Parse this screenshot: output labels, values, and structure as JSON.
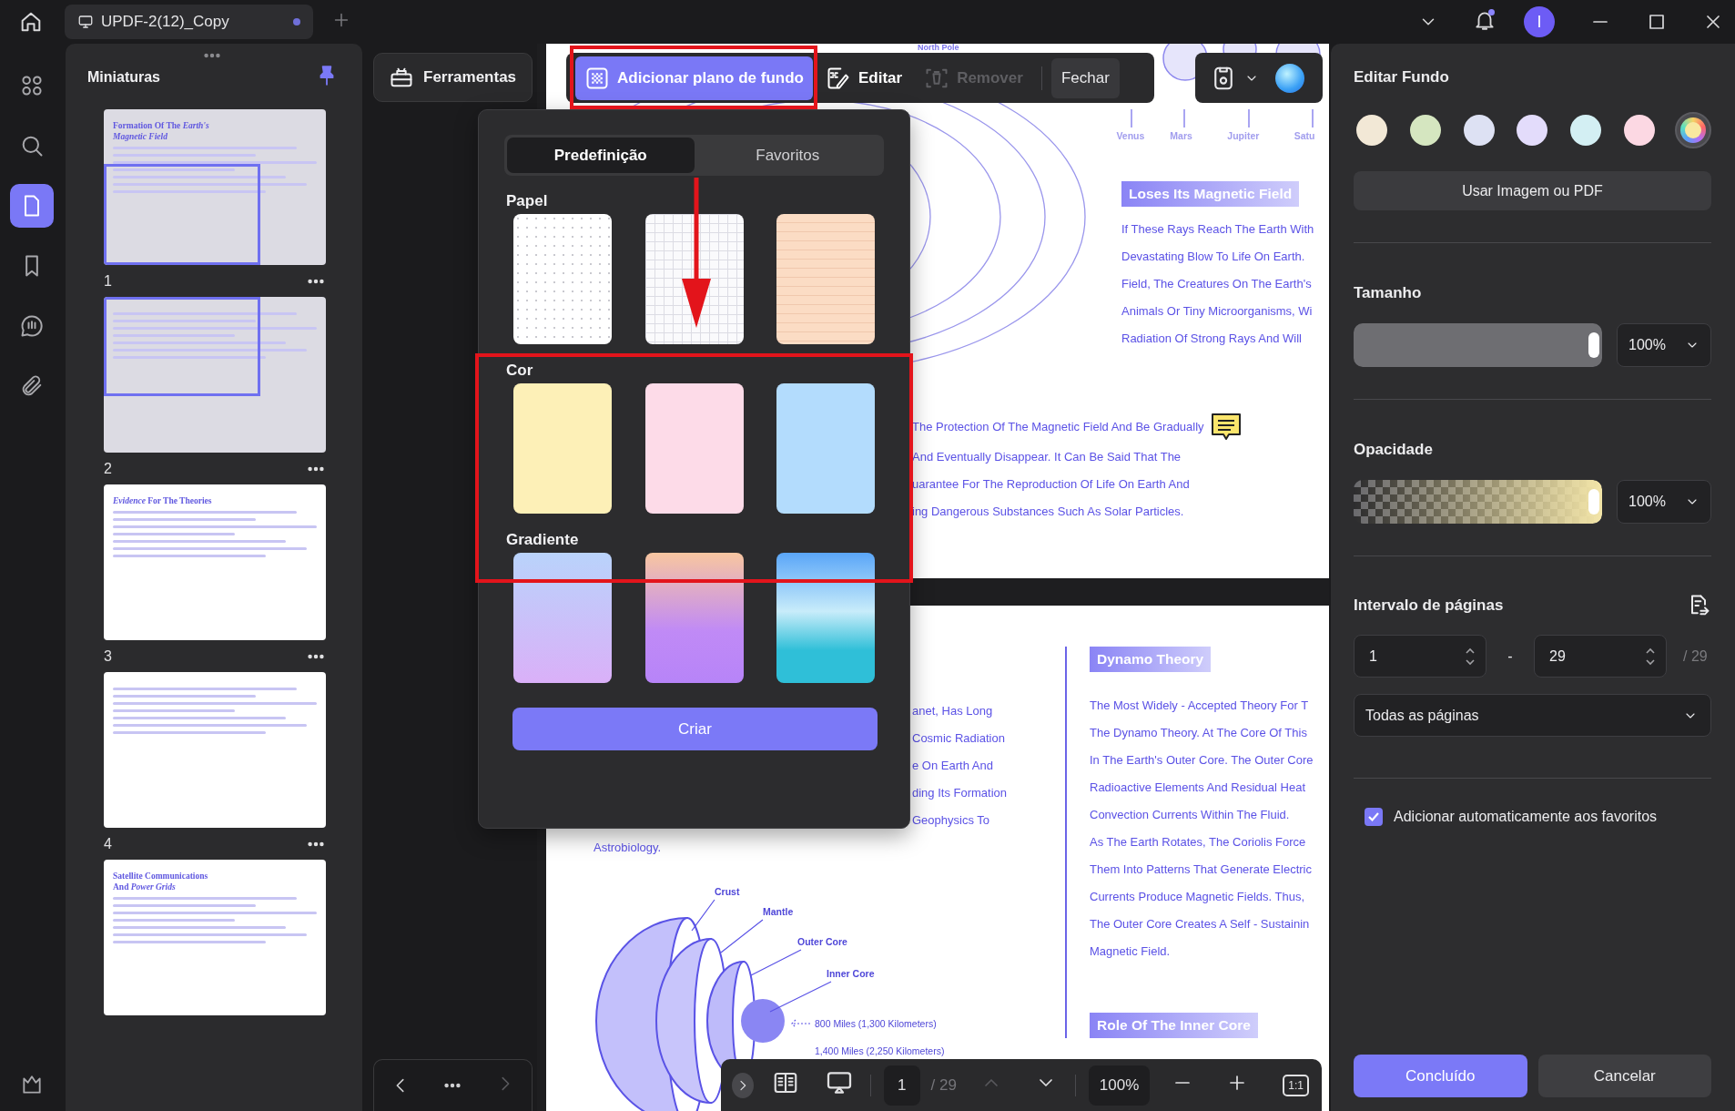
{
  "top_bar": {
    "tab_title": "UPDF-2(12)_Copy",
    "unsaved": true,
    "avatar_letter": "I"
  },
  "nav_rail": [
    {
      "selected": false
    },
    {
      "selected": false
    },
    {
      "selected": true
    },
    {
      "selected": false
    },
    {
      "selected": false
    },
    {
      "selected": false
    }
  ],
  "thumbnails": {
    "title": "Miniaturas",
    "pinned": true,
    "pages": [
      {
        "label": "1",
        "title": "Formation Of The *Earth's Magnetic Field*",
        "in_view": true
      },
      {
        "label": "2",
        "in_view": true
      },
      {
        "label": "3",
        "title": "*Evidence* For The Theories",
        "in_view": false
      },
      {
        "label": "4",
        "in_view": false
      },
      {
        "title": "Satellite Communications And *Power Grids*",
        "in_view": false
      }
    ]
  },
  "tools": {
    "button": "Ferramentas",
    "next_disabled": true
  },
  "toolbar": {
    "buttons": [
      {
        "label": "Adicionar plano de fundo",
        "selected": true,
        "disabled": false
      },
      {
        "label": "Editar",
        "selected": false,
        "disabled": false
      },
      {
        "label": "Remover",
        "selected": false,
        "disabled": true
      }
    ],
    "close": "Fechar"
  },
  "popup": {
    "tabs": [
      {
        "label": "Predefinição",
        "selected": true
      },
      {
        "label": "Favoritos",
        "selected": false
      }
    ],
    "sections": [
      {
        "title": "Papel",
        "swatches": [
          {
            "kind": "dots"
          },
          {
            "kind": "grid"
          },
          {
            "kind": "lined"
          }
        ]
      },
      {
        "title": "Cor",
        "swatches": [
          {
            "kind": "solid",
            "color": "#fdf0b7"
          },
          {
            "kind": "solid",
            "color": "#fddbe8"
          },
          {
            "kind": "solid",
            "color": "#b3dcfd"
          }
        ]
      },
      {
        "title": "Gradiente",
        "swatches": [
          {
            "kind": "gradient"
          },
          {
            "kind": "gradient"
          },
          {
            "kind": "gradient"
          }
        ]
      }
    ],
    "create_button": "Criar"
  },
  "document": {
    "page_1": {
      "north_label": "North Pole",
      "planet_labels": [
        "Venus",
        "Mars",
        "Jupiter",
        "Satu"
      ],
      "heading": "Loses Its Magnetic Field",
      "lines": [
        "If These Rays Reach The Earth With",
        "Devastating Blow To Life On Earth.",
        "Field, The Creatures On The Earth's",
        "Animals Or Tiny Microorganisms, Wi",
        "Radiation Of Strong Rays And Will"
      ],
      "lower_lines": [
        "The Protection Of The Magnetic Field And Be Gradually",
        "And Eventually Disappear. It Can Be Said That The",
        "uarantee For The Reproduction Of Life On Earth And",
        "ing Dangerous Substances Such As Solar Particles."
      ]
    },
    "page_2": {
      "left_lines": [
        "anet, Has Long",
        "Cosmic Radiation",
        "e On Earth And",
        "ding Its Formation",
        "Geophysics To"
      ],
      "left_tail": "Astrobiology.",
      "figure_labels": [
        "Crust",
        "Mantle",
        "Outer Core",
        "Inner Core"
      ],
      "figure_notes": [
        "800 Miles (1,300 Kilometers)",
        "1,400 Miles (2,250 Kilometers)"
      ],
      "heading": "Dynamo Theory",
      "lines": [
        "The Most Widely - Accepted Theory For T",
        "The Dynamo Theory. At The Core Of This",
        "In The Earth's Outer Core. The Outer Core",
        "Radioactive Elements And Residual Heat",
        "Convection Currents Within The Fluid.",
        "As The Earth Rotates, The Coriolis Force",
        "Them Into Patterns That Generate Electric",
        "Currents Produce Magnetic Fields. Thus,",
        "The Outer Core Creates A Self - Sustainin",
        "Magnetic Field."
      ],
      "next_heading": "Role Of The Inner Core"
    }
  },
  "doc_toolbar": {
    "page": "1",
    "total": "/ 29",
    "prev_disabled": true,
    "zoom": "100%",
    "actual_size": "1:1"
  },
  "edit_panel": {
    "title": "Editar Fundo",
    "colors": [
      {
        "kind": "solid",
        "color": "#f2e8d6",
        "selected": false
      },
      {
        "kind": "solid",
        "color": "#d5e6c0",
        "selected": false
      },
      {
        "kind": "solid",
        "color": "#dde1f3",
        "selected": false
      },
      {
        "kind": "solid",
        "color": "#e3dcfb",
        "selected": false
      },
      {
        "kind": "solid",
        "color": "#d3eff3",
        "selected": false
      },
      {
        "kind": "solid",
        "color": "#fcd8e3",
        "selected": false
      },
      {
        "kind": "picker",
        "selected": true
      }
    ],
    "image_button": "Usar Imagem ou PDF",
    "size": {
      "label": "Tamanho",
      "level": 1,
      "value": "100%"
    },
    "opacity": {
      "label": "Opacidade",
      "level": 1,
      "value": "100%"
    },
    "range": {
      "label": "Intervalo de páginas",
      "from": "1",
      "separator": "-",
      "to": "29",
      "total": "/ 29",
      "mode": "Todas as páginas"
    },
    "auto_favorite": {
      "label": "Adicionar automaticamente aos favoritos",
      "checked": true
    },
    "buttons": [
      {
        "label": "Concluído",
        "kind": "primary"
      },
      {
        "label": "Cancelar",
        "kind": "secondary"
      }
    ]
  }
}
